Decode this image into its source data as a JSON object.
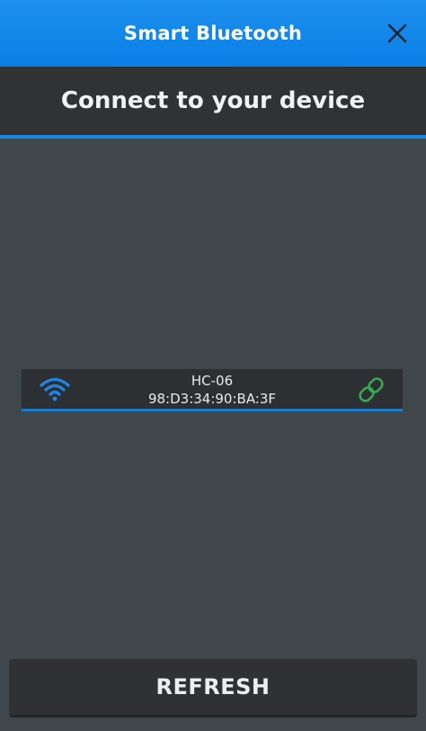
{
  "titlebar": {
    "title": "Smart Bluetooth",
    "close_icon": "close-icon",
    "color": "#0a7fe6"
  },
  "header": {
    "text": "Connect to your device",
    "accent": "#1a86e8"
  },
  "devices": [
    {
      "name": "HC-06",
      "mac": "98:D3:34:90:BA:3F",
      "signal_icon": "wifi-signal-icon",
      "signal_color": "#1f86e8",
      "link_icon": "link-icon",
      "link_color": "#3aa650"
    }
  ],
  "footer": {
    "refresh_label": "REFRESH"
  }
}
